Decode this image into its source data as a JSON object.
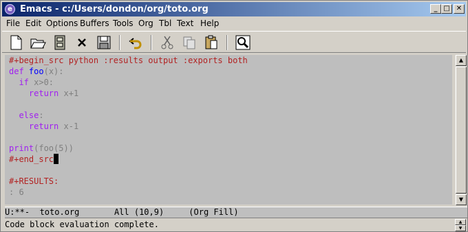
{
  "window": {
    "title": "Emacs - c:/Users/dondon/org/toto.org"
  },
  "menu": [
    "File",
    "Edit",
    "Options",
    "Buffers",
    "Tools",
    "Org",
    "Tbl",
    "Text",
    "Help"
  ],
  "toolbar": [
    {
      "name": "new-file-icon"
    },
    {
      "name": "open-folder-icon"
    },
    {
      "name": "dired-cabinet-icon"
    },
    {
      "name": "close-buffer-icon"
    },
    {
      "name": "save-icon"
    },
    {
      "name": "undo-icon"
    },
    {
      "name": "cut-icon"
    },
    {
      "name": "copy-icon"
    },
    {
      "name": "paste-icon"
    },
    {
      "name": "search-icon"
    }
  ],
  "code": {
    "line1": "#+begin_src python :results output :exports both",
    "line2_kw": "def",
    "line2_fn": "foo",
    "line2_rest": "(x):",
    "line3_kw": "if",
    "line3_rest": " x>0:",
    "line4_kw": "return",
    "line4_rest": " x+1",
    "line6_kw": "else",
    "line6_rest": ":",
    "line7_kw": "return",
    "line7_rest": " x-1",
    "line9_kw": "print",
    "line9_rest": "(foo(5))",
    "line10": "#+end_src",
    "line12": "#+RESULTS:",
    "line13": ": 6"
  },
  "modeline": "U:**-  toto.org       All (10,9)     (Org Fill)",
  "echo": "Code block evaluation complete."
}
